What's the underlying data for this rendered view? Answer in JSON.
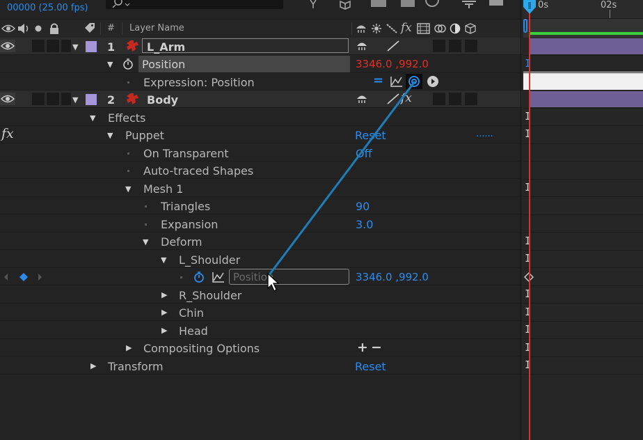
{
  "header": {
    "timecode": "00000 (25.00 fps)",
    "layer_name_col": "Layer Name",
    "col_hash": "#"
  },
  "timeline": {
    "ruler_labels": [
      "0s",
      "02s"
    ]
  },
  "layers": [
    {
      "num": "1",
      "name": "L_Arm",
      "position_label": "Position",
      "position_value": "3346.0 ,992.0",
      "expression_label": "Expression: Position",
      "label_color": "#a496d8"
    },
    {
      "num": "2",
      "name": "Body",
      "label_color": "#a496d8"
    }
  ],
  "tree": {
    "effects": "Effects",
    "puppet": "Puppet",
    "puppet_reset": "Reset",
    "puppet_dots": "......",
    "on_transparent": "On Transparent",
    "on_transparent_value": "Off",
    "auto_traced": "Auto-traced Shapes",
    "mesh": "Mesh 1",
    "triangles": "Triangles",
    "triangles_value": "90",
    "expansion": "Expansion",
    "expansion_value": "3.0",
    "deform": "Deform",
    "l_shoulder": "L_Shoulder",
    "l_shoulder_field": "Position",
    "l_shoulder_value": "3346.0 ,992.0",
    "r_shoulder": "R_Shoulder",
    "chin": "Chin",
    "head": "Head",
    "compositing": "Compositing Options",
    "comp_plus": "+",
    "comp_minus": "−",
    "transform": "Transform",
    "transform_reset": "Reset"
  },
  "icons": {
    "fx": "fx"
  },
  "colors": {
    "accent": "#2d8ceb",
    "value_red": "#e0302a",
    "pickwhip": "#1d7eb9",
    "playhead": "#e0302a",
    "label_purple": "#a496d8",
    "work_area": "#3ad13a"
  }
}
